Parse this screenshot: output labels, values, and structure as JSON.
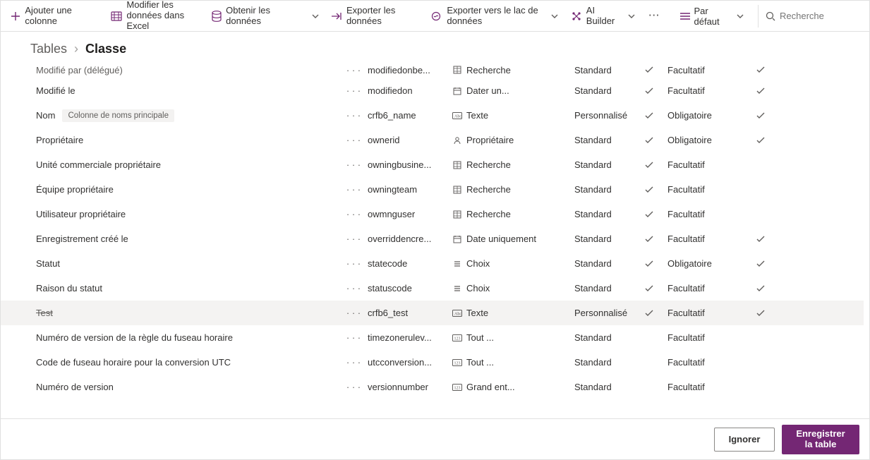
{
  "toolbar": {
    "add_column": "Ajouter une colonne",
    "edit_excel": "Modifier les données dans Excel",
    "get_data": "Obtenir les données",
    "export_data": "Exporter les données",
    "export_lake": "Exporter vers le lac de données",
    "ai_builder": "AI Builder",
    "default_view": "Par défaut",
    "search_placeholder": "Recherche"
  },
  "breadcrumb": {
    "root": "Tables",
    "current": "Classe"
  },
  "rows": [
    {
      "display": "Modifié par (délégué)",
      "cut": true,
      "more": true,
      "sys": "modifiedonbe...",
      "dtype_ic": "lookup",
      "dtype": "Recherche",
      "mgd": "Standard",
      "cust": true,
      "req": "Facultatif",
      "srch": true
    },
    {
      "display": "Modifié le",
      "more": true,
      "sys": "modifiedon",
      "dtype_ic": "date",
      "dtype": "Dater un...",
      "mgd": "Standard",
      "cust": true,
      "req": "Facultatif",
      "srch": true
    },
    {
      "display": "Nom",
      "badge": "Colonne de noms principale",
      "more": true,
      "sys": "crfb6_name",
      "dtype_ic": "text",
      "dtype": "Texte",
      "mgd": "Personnalisé",
      "cust": true,
      "req": "Obligatoire",
      "srch": true
    },
    {
      "display": "Propriétaire",
      "more": true,
      "sys": "ownerid",
      "dtype_ic": "owner",
      "dtype": "Propriétaire",
      "mgd": "Standard",
      "cust": true,
      "req": "Obligatoire",
      "srch": true
    },
    {
      "display": "Unité commerciale propriétaire",
      "more": true,
      "sys": "owningbusine...",
      "dtype_ic": "lookup",
      "dtype": "Recherche",
      "mgd": "Standard",
      "cust": true,
      "req": "Facultatif"
    },
    {
      "display": "Équipe propriétaire",
      "more": true,
      "sys": "owningteam",
      "dtype_ic": "lookup",
      "dtype": "Recherche",
      "mgd": "Standard",
      "cust": true,
      "req": "Facultatif"
    },
    {
      "display": "Utilisateur propriétaire",
      "more": true,
      "sys": "owmnguser",
      "dtype_ic": "lookup",
      "dtype": "Recherche",
      "mgd": "Standard",
      "cust": true,
      "req": "Facultatif"
    },
    {
      "display": "Enregistrement créé le",
      "more": true,
      "sys": "overriddencre...",
      "dtype_ic": "date",
      "dtype": "Date uniquement",
      "mgd": "Standard",
      "cust": true,
      "req": "Facultatif",
      "srch": true
    },
    {
      "display": "Statut",
      "more": true,
      "sys": "statecode",
      "dtype_ic": "choice",
      "dtype": "Choix",
      "mgd": "Standard",
      "cust": true,
      "req": "Obligatoire",
      "srch": true
    },
    {
      "display": "Raison du statut",
      "more": true,
      "sys": "statuscode",
      "dtype_ic": "choice",
      "dtype": "Choix",
      "mgd": "Standard",
      "cust": true,
      "req": "Facultatif",
      "srch": true
    },
    {
      "display": "Test",
      "strike": true,
      "alt": true,
      "more": true,
      "sys": "crfb6_test",
      "dtype_ic": "text",
      "dtype": "Texte",
      "mgd": "Personnalisé",
      "cust": true,
      "req": "Facultatif",
      "srch": true
    },
    {
      "display": "Numéro de version de la règle du fuseau horaire",
      "more": true,
      "sys": "timezonerulev...",
      "dtype_ic": "number",
      "dtype": "Tout ...",
      "mgd": "Standard",
      "req": "Facultatif"
    },
    {
      "display": "Code de fuseau horaire pour la conversion UTC",
      "more": true,
      "sys": "utcconversion...",
      "dtype_ic": "number",
      "dtype": "Tout ...",
      "mgd": "Standard",
      "req": "Facultatif"
    },
    {
      "display": "Numéro de version",
      "more": true,
      "sys": "versionnumber",
      "dtype_ic": "number",
      "dtype": "Grand ent...",
      "mgd": "Standard",
      "req": "Facultatif"
    }
  ],
  "footer": {
    "cancel": "Ignorer",
    "save": "Enregistrer la table"
  }
}
